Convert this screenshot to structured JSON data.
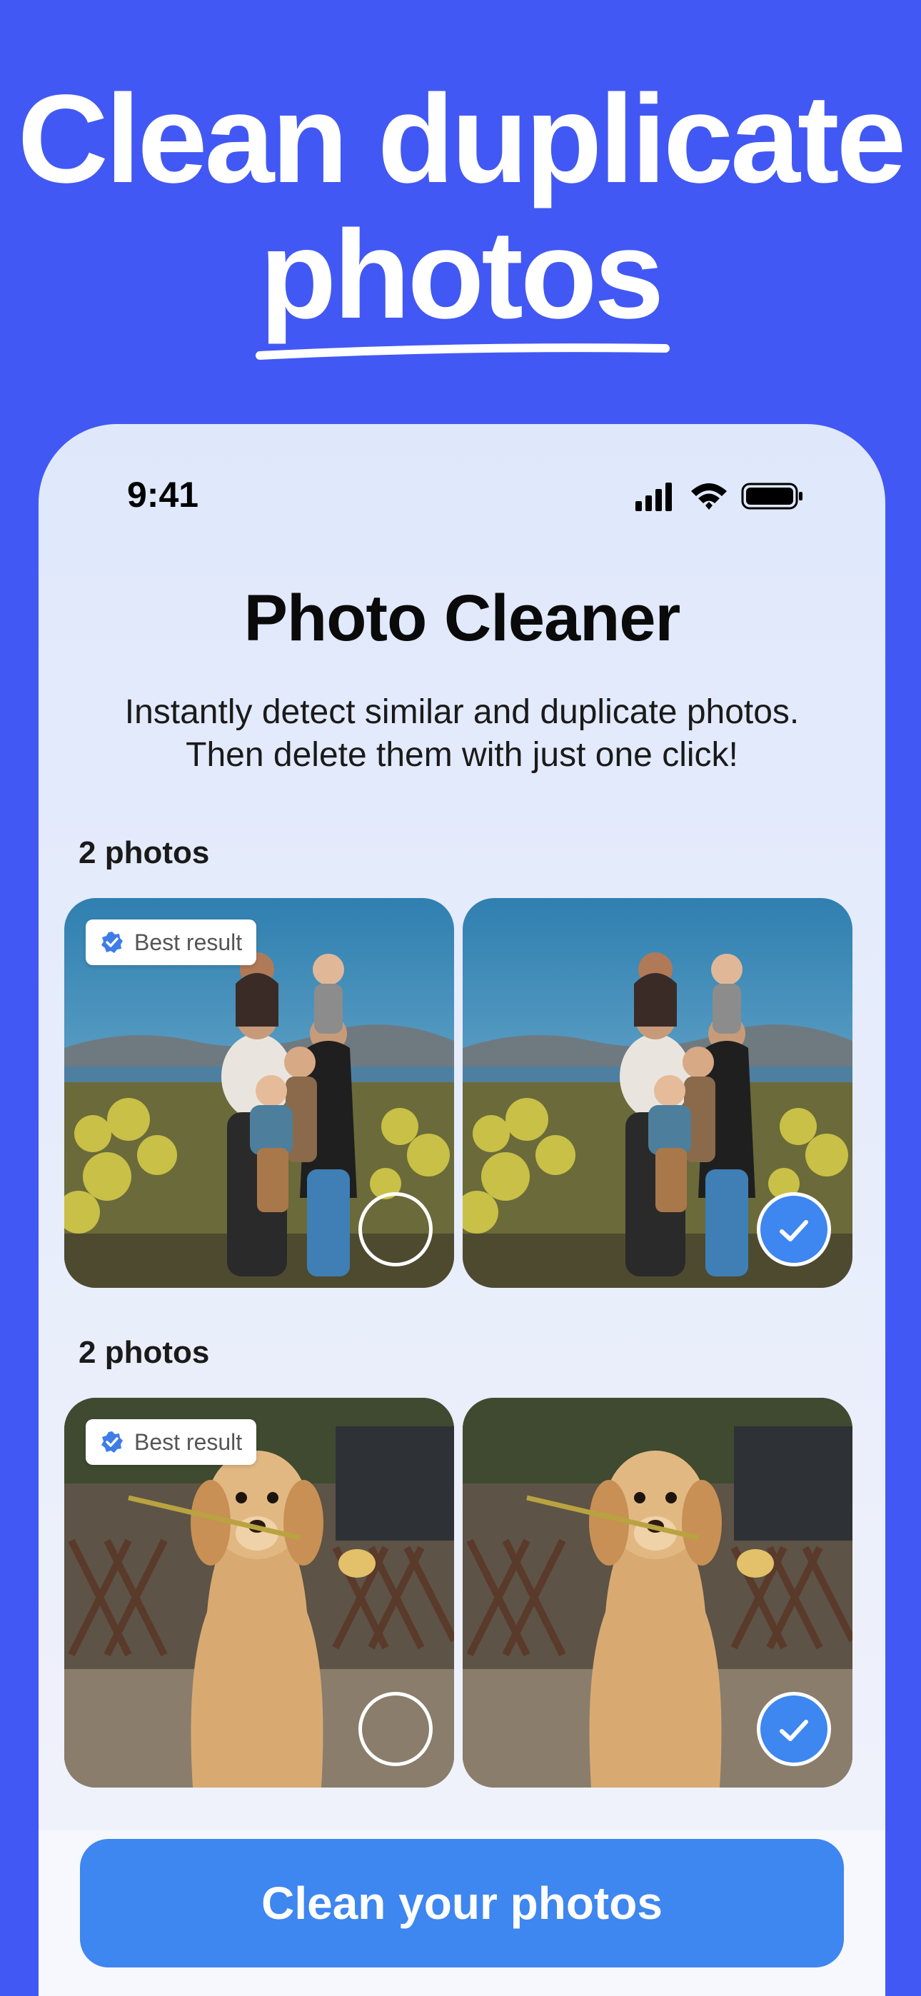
{
  "headline": {
    "line1": "Clean duplicate",
    "line2": "photos"
  },
  "status_bar": {
    "time": "9:41"
  },
  "app": {
    "title": "Photo Cleaner",
    "subtitle_line1": "Instantly detect similar and duplicate photos.",
    "subtitle_line2": "Then delete them with just one click!"
  },
  "groups": [
    {
      "label": "2 photos",
      "subject": "family",
      "photos": [
        {
          "badge": "Best result",
          "selected": false
        },
        {
          "badge": "",
          "selected": true
        }
      ]
    },
    {
      "label": "2 photos",
      "subject": "dog",
      "photos": [
        {
          "badge": "Best result",
          "selected": false
        },
        {
          "badge": "",
          "selected": true
        }
      ]
    }
  ],
  "cta": {
    "label": "Clean your photos"
  },
  "colors": {
    "background": "#4258F4",
    "accent": "#3E86F0",
    "badge_check": "#3E7DE8"
  }
}
